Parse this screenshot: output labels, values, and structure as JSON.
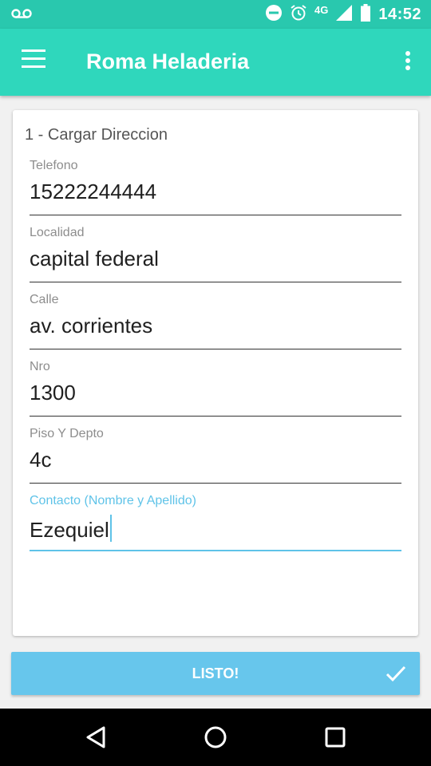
{
  "status_bar": {
    "network": "4G",
    "time": "14:52",
    "icons": [
      "voicemail-icon",
      "do-not-disturb-icon",
      "alarm-icon",
      "signal-icon",
      "battery-icon"
    ]
  },
  "app_bar": {
    "title": "Roma Heladeria",
    "icons": [
      "menu-icon",
      "overflow-menu-icon"
    ]
  },
  "form": {
    "heading": "1 - Cargar Direccion",
    "fields": [
      {
        "label": "Telefono",
        "value": "15222244444"
      },
      {
        "label": "Localidad",
        "value": "capital federal"
      },
      {
        "label": "Calle",
        "value": "av. corrientes"
      },
      {
        "label": "Nro",
        "value": "1300"
      },
      {
        "label": "Piso Y Depto",
        "value": "4c"
      },
      {
        "label": "Contacto (Nombre y Apellido)",
        "value": "Ezequiel",
        "focused": true
      }
    ],
    "accent_color": "#5fc3e8"
  },
  "submit_button": {
    "label": "LISTO!",
    "icon": "check-icon",
    "color": "#67c6ec"
  },
  "nav_bar": {
    "icons": [
      "back-icon",
      "home-icon",
      "recents-icon"
    ]
  },
  "colors": {
    "status_bar": "#29c8ae",
    "app_bar": "#2fd7bc"
  }
}
